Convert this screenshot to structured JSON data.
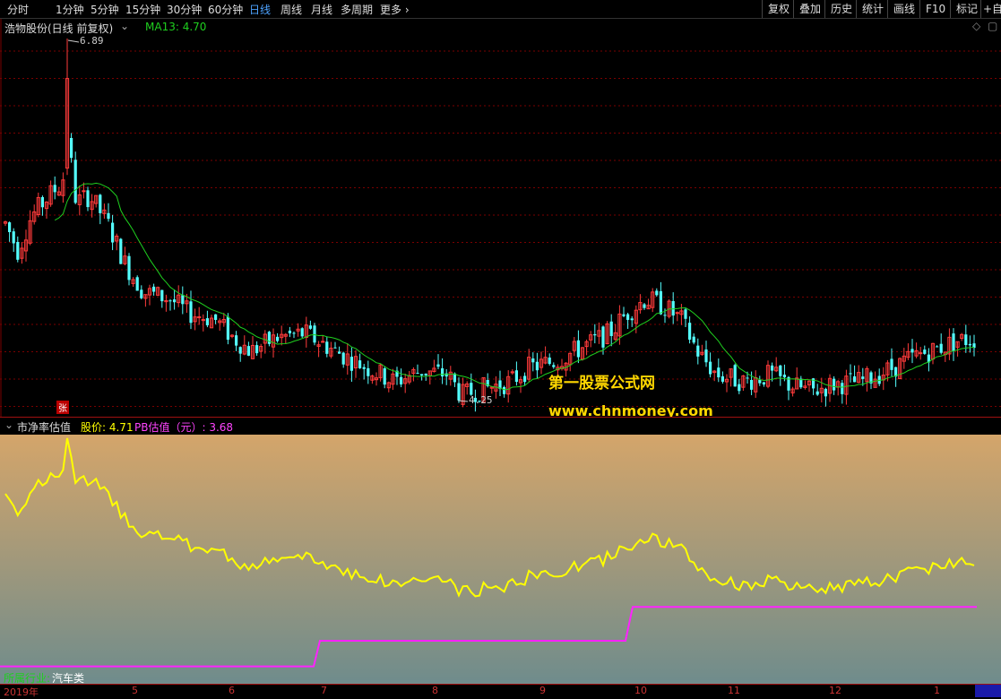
{
  "toolbar": {
    "periods": [
      "分时",
      "1分钟",
      "5分钟",
      "15分钟",
      "30分钟",
      "60分钟",
      "日线",
      "周线",
      "月线",
      "多周期",
      "更多"
    ],
    "active_period": "日线",
    "right_buttons": [
      "复权",
      "叠加",
      "历史",
      "统计",
      "画线",
      "F10",
      "标记",
      "+自"
    ]
  },
  "main_panel": {
    "stock_title": "浩物股份(日线 前复权)",
    "ma_label": "MA13: 4.70",
    "high_label": "6.89",
    "low_label": "4.25",
    "marker": "张",
    "colors": {
      "up": "#ff3b3b",
      "down": "#54ffff",
      "ma": "#1fcf1f",
      "grid": "#7a0000"
    }
  },
  "sub_panel": {
    "indicator_name": "市净率估值",
    "price_label": "股价: 4.71",
    "pb_label": "PB估值（元）: 3.68",
    "industry_label": "所属行业:",
    "industry_value": "汽车类",
    "colors": {
      "price_line": "#ffff00",
      "pb_line": "#ff22ff"
    }
  },
  "watermark": {
    "line1": "第一股票公式网",
    "line2": "www.chnmoney.com"
  },
  "xaxis": {
    "labels": [
      "2019年",
      "5",
      "6",
      "7",
      "8",
      "9",
      "10",
      "11",
      "12",
      "1"
    ]
  },
  "series": {
    "pb_value_steps": [
      3.1,
      3.35,
      3.68
    ],
    "price_high": 6.89,
    "price_low": 4.25,
    "price_last": 4.71
  }
}
